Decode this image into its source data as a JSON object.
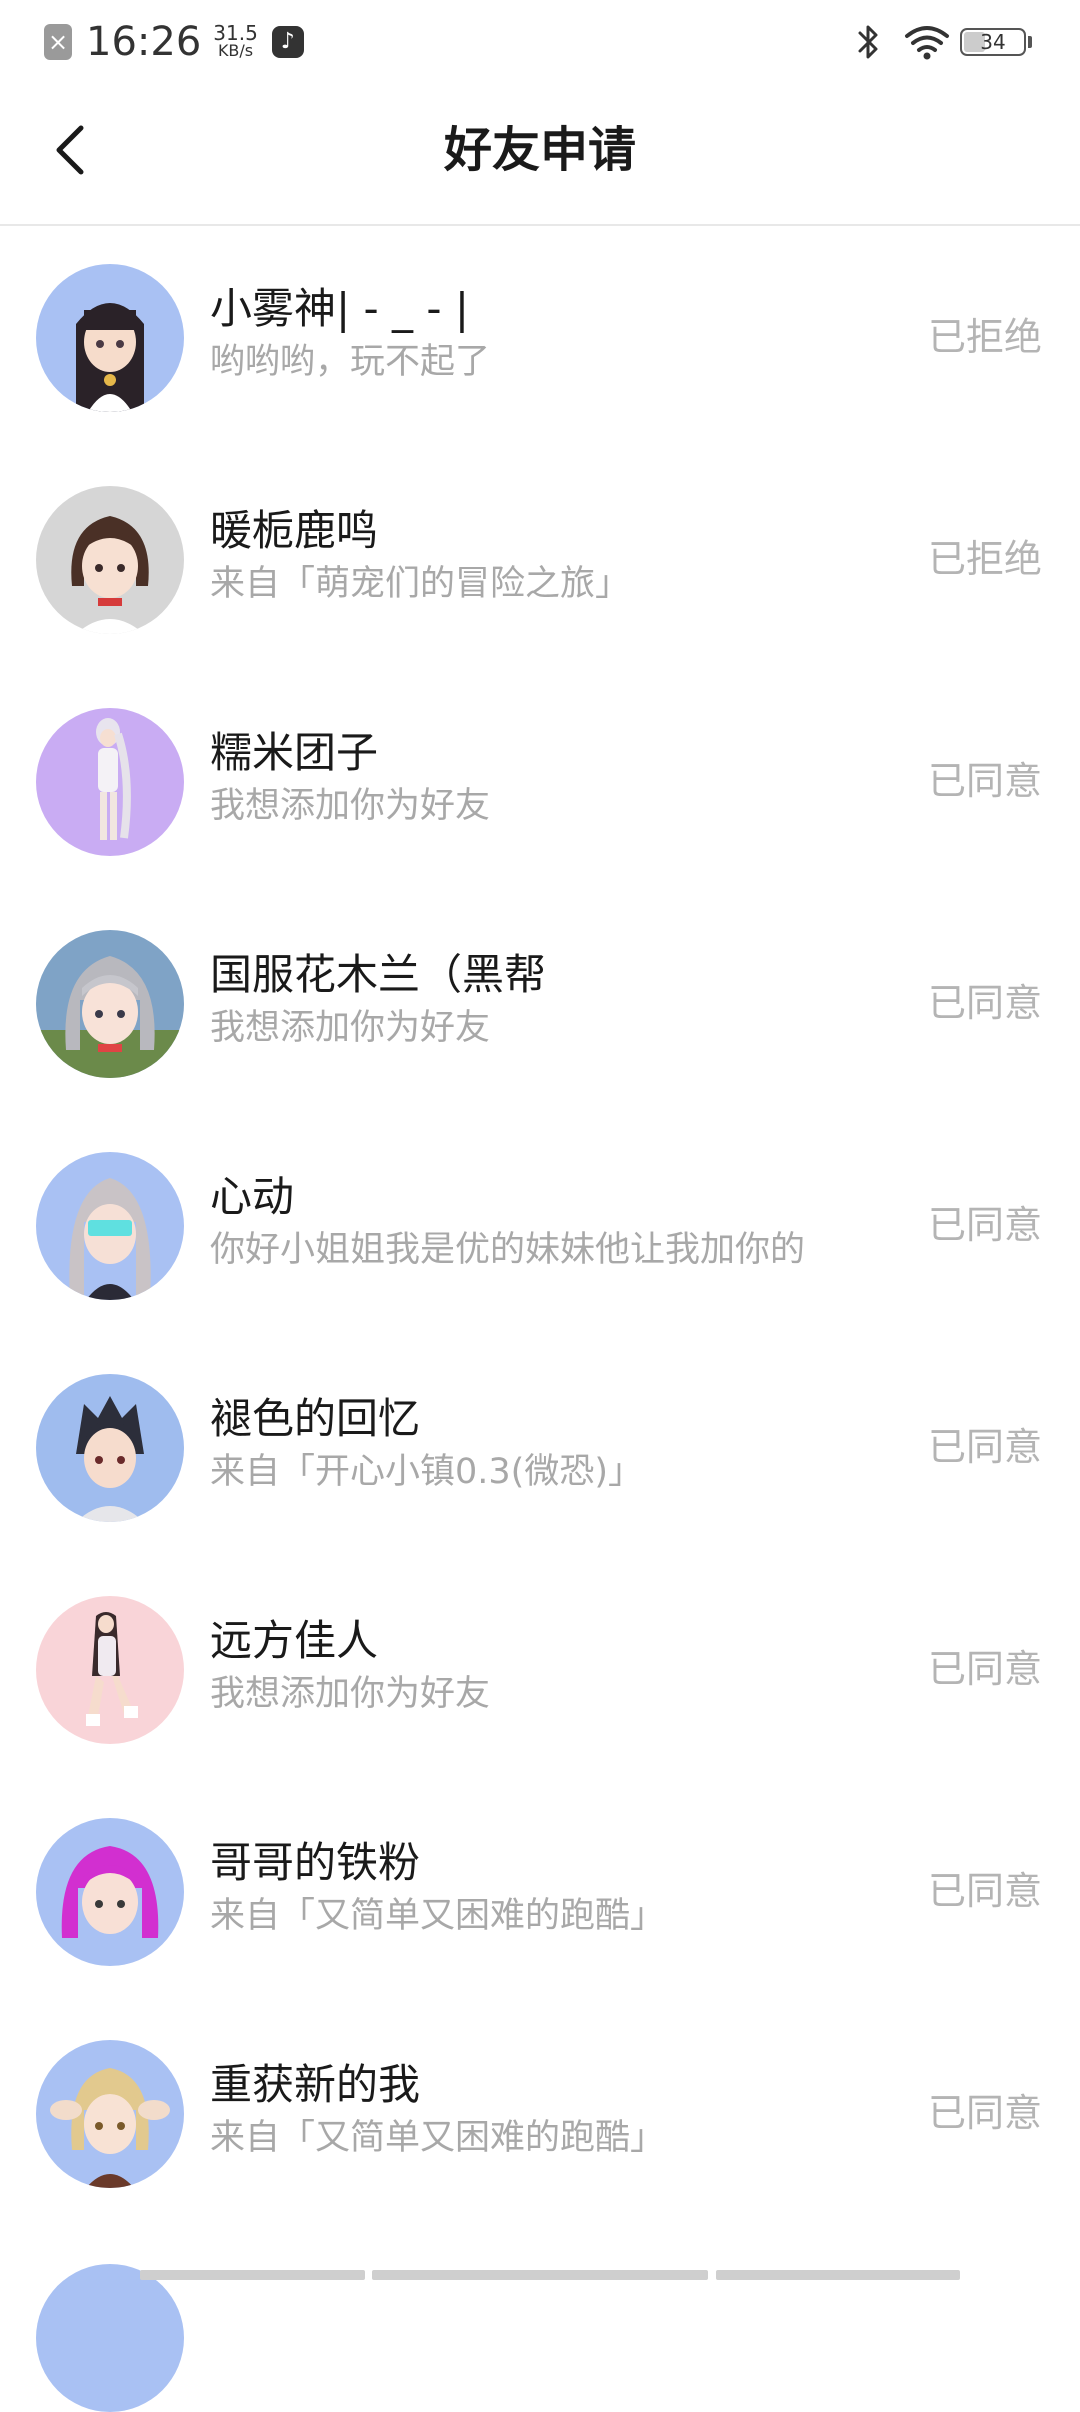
{
  "status_bar": {
    "time": "16:26",
    "speed_value": "31.5",
    "speed_unit": "KB/s",
    "battery": "34",
    "icons": [
      "notification-x-icon",
      "tiktok-icon",
      "bluetooth-icon",
      "wifi-icon",
      "battery-icon"
    ]
  },
  "header": {
    "title": "好友申请",
    "back_icon": "chevron-left-icon"
  },
  "colors": {
    "status_text": "#b4b4b4",
    "subtext": "#a8a8a8",
    "divider": "#e8e8e8"
  },
  "requests": [
    {
      "name": "小雾神| - _ - |",
      "message": "哟哟哟，玩不起了",
      "status": "已拒绝",
      "avatar": "female-character-avatar"
    },
    {
      "name": "暖栀鹿鸣",
      "message": "来自「萌宠们的冒险之旅」",
      "status": "已拒绝",
      "avatar": "female-character-avatar"
    },
    {
      "name": "糯米团子",
      "message": "我想添加你为好友",
      "status": "已同意",
      "avatar": "female-character-avatar"
    },
    {
      "name": "国服花木兰（黑帮",
      "message": "我想添加你为好友",
      "status": "已同意",
      "avatar": "female-character-avatar"
    },
    {
      "name": "心动",
      "message": "你好小姐姐我是优的妹妹他让我加你的",
      "status": "已同意",
      "avatar": "female-character-avatar"
    },
    {
      "name": "褪色的回忆",
      "message": "来自「开心小镇0.3(微恐)」",
      "status": "已同意",
      "avatar": "male-character-avatar"
    },
    {
      "name": "远方佳人",
      "message": "我想添加你为好友",
      "status": "已同意",
      "avatar": "female-character-avatar"
    },
    {
      "name": "哥哥的铁粉",
      "message": "来自「又简单又困难的跑酷」",
      "status": "已同意",
      "avatar": "female-character-avatar"
    },
    {
      "name": "重获新的我",
      "message": "来自「又简单又困难的跑酷」",
      "status": "已同意",
      "avatar": "female-character-avatar"
    }
  ]
}
